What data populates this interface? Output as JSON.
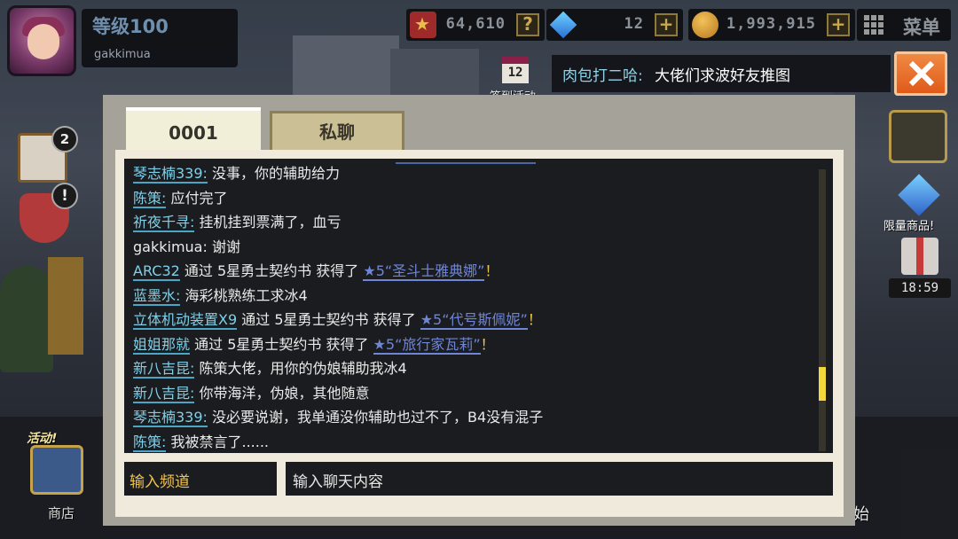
{
  "hud": {
    "level": "等级100",
    "player_name": "gakkimua",
    "resources": [
      {
        "icon": "medal-icon",
        "value": "64,610",
        "button": "?"
      },
      {
        "icon": "gem-icon",
        "value": "12",
        "button": "+"
      },
      {
        "icon": "coin-icon",
        "value": "1,993,915",
        "button": "+"
      }
    ],
    "menu_label": "菜单"
  },
  "signin": {
    "date": "12",
    "label": "签到活动"
  },
  "broadcast": {
    "sender": "肉包打二哈:",
    "message": "大佬们求波好友推图"
  },
  "side": {
    "mail_badge": "2",
    "alert_badge": "!",
    "activity_label": "活动!",
    "shop_label": "商店",
    "start_label": "开始",
    "limited_label": "限量商品!",
    "timer": "18:59"
  },
  "tabs": [
    {
      "label": "0001",
      "active": true
    },
    {
      "label": "私聊",
      "active": false
    }
  ],
  "messages": [
    {
      "sender": "琴志楠339:",
      "parts": [
        {
          "t": "没事，你的辅助给力"
        }
      ]
    },
    {
      "sender": "陈策:",
      "parts": [
        {
          "t": "应付完了"
        }
      ]
    },
    {
      "sender": "祈夜千寻:",
      "parts": [
        {
          "t": "挂机挂到票满了，血亏"
        }
      ]
    },
    {
      "sender": "gakkimua:",
      "plain": true,
      "parts": [
        {
          "t": "谢谢"
        }
      ]
    },
    {
      "sender": "ARC32",
      "parts": [
        {
          "t": "通过 5星勇士契约书 获得了 "
        },
        {
          "t": "★5“圣斗士雅典娜”",
          "item": true
        },
        {
          "t": "！",
          "ex": true
        }
      ]
    },
    {
      "sender": "蓝墨水:",
      "parts": [
        {
          "t": "海彩桃熟练工求冰4"
        }
      ]
    },
    {
      "sender": "立体机动装置X9",
      "parts": [
        {
          "t": "通过 5星勇士契约书 获得了 "
        },
        {
          "t": "★5“代号斯佩妮”",
          "item": true
        },
        {
          "t": "！",
          "ex": true
        }
      ]
    },
    {
      "sender": "姐姐那就",
      "parts": [
        {
          "t": "通过 5星勇士契约书 获得了 "
        },
        {
          "t": "★5“旅行家瓦莉”",
          "item": true
        },
        {
          "t": "！",
          "ex": true
        }
      ]
    },
    {
      "sender": "新八吉昆:",
      "parts": [
        {
          "t": "陈策大佬，用你的伪娘辅助我冰4"
        }
      ]
    },
    {
      "sender": "新八吉昆:",
      "parts": [
        {
          "t": "你带海洋，伪娘，其他随意"
        }
      ]
    },
    {
      "sender": "琴志楠339:",
      "parts": [
        {
          "t": "没必要说谢，我单通没你辅助也过不了，B4没有混子"
        }
      ]
    },
    {
      "sender": "陈策:",
      "parts": [
        {
          "t": "我被禁言了......"
        }
      ]
    }
  ],
  "inputs": {
    "channel_placeholder": "输入频道",
    "message_placeholder": "输入聊天内容"
  },
  "colors": {
    "close_button": "#e8692a",
    "sender_name": "#7fd0e8",
    "item_link": "#6f86d6",
    "channel_text": "#f0c44c",
    "scroll_thumb": "#f3d83a"
  }
}
